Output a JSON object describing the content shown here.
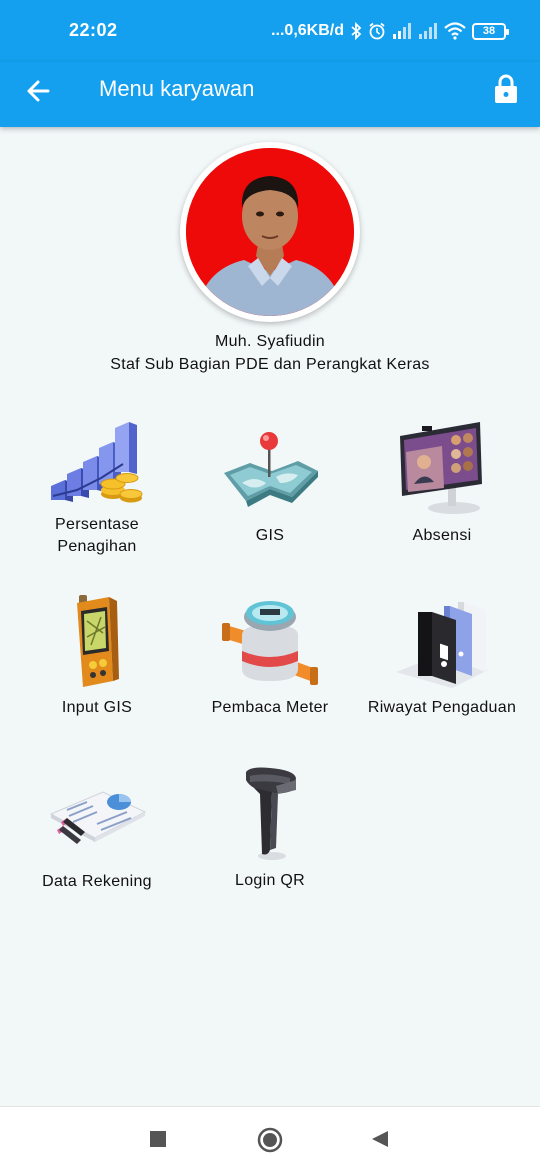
{
  "status_bar": {
    "time": "22:02",
    "network_speed": "...0,6KB/d",
    "battery": "38",
    "icons": [
      "bluetooth-icon",
      "alarm-icon",
      "signal-icon",
      "signal-icon-2",
      "wifi-icon",
      "battery-icon"
    ]
  },
  "app_bar": {
    "title": "Menu karyawan",
    "back_icon": "arrow-left-icon",
    "lock_icon": "lock-icon"
  },
  "profile": {
    "name": "Muh. Syafiudin",
    "role": "Staf Sub Bagian PDE dan Perangkat Keras"
  },
  "menu": [
    {
      "label_line1": "Persentase",
      "label_line2": "Penagihan",
      "icon": "growth-chart-coins-icon"
    },
    {
      "label": "GIS",
      "icon": "map-pin-icon"
    },
    {
      "label": "Absensi",
      "icon": "video-monitor-icon"
    },
    {
      "label": "Input GIS",
      "icon": "gps-device-icon"
    },
    {
      "label": "Pembaca Meter",
      "icon": "water-meter-icon"
    },
    {
      "label": "Riwayat Pengaduan",
      "icon": "binders-icon"
    },
    {
      "label": "Data Rekening",
      "icon": "document-chart-icon"
    },
    {
      "label": "Login QR",
      "icon": "barcode-scanner-icon"
    }
  ],
  "nav_bar": {
    "recent_icon": "square-icon",
    "home_icon": "circle-home-icon",
    "back_icon": "triangle-back-icon"
  },
  "colors": {
    "primary": "#14a0ee",
    "background": "#f2f7f8",
    "avatar_bg": "#ee0a09"
  }
}
